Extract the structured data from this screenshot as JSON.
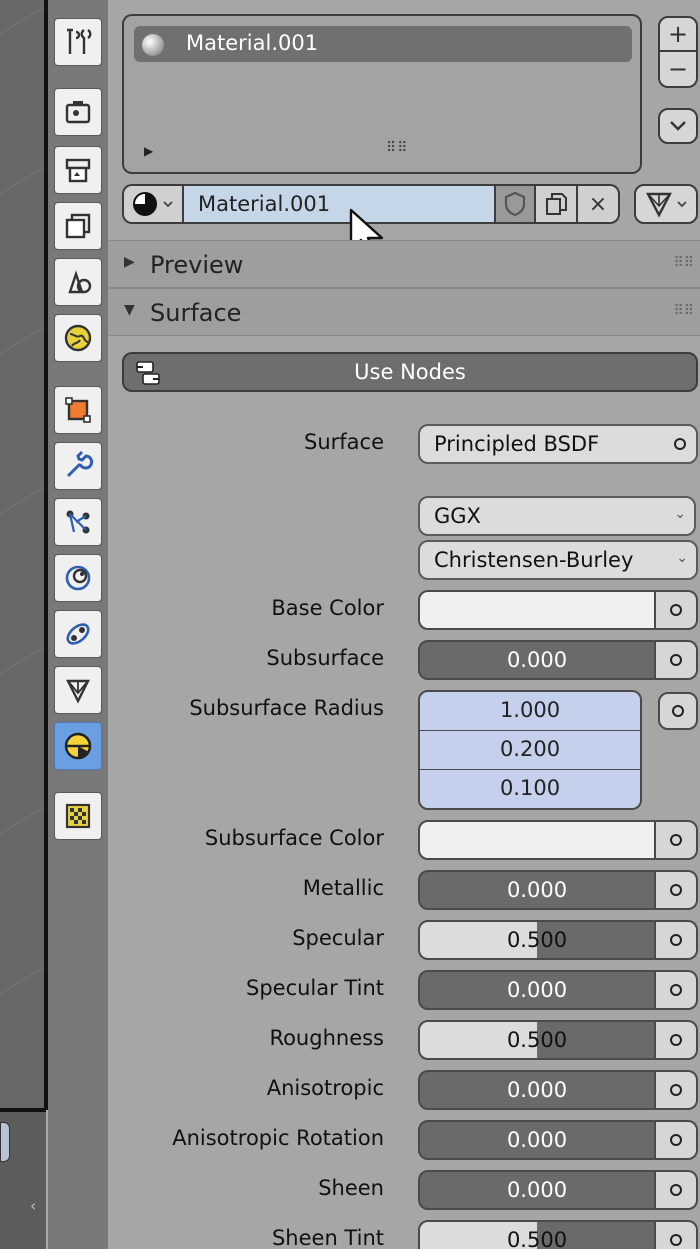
{
  "material_slots": {
    "items": [
      {
        "name": "Material.001"
      }
    ],
    "add_label": "+",
    "remove_label": "−"
  },
  "datablock": {
    "name": "Material.001",
    "unlink_label": "×"
  },
  "panels": {
    "preview": "Preview",
    "surface": "Surface"
  },
  "surface": {
    "use_nodes": "Use Nodes",
    "surface_label": "Surface",
    "surface_shader": "Principled BSDF",
    "distribution": "GGX",
    "subsurface_method": "Christensen-Burley",
    "properties": [
      {
        "label": "Base Color",
        "kind": "color",
        "color": "#f0f0f0"
      },
      {
        "label": "Subsurface",
        "kind": "value",
        "value": "0.000",
        "fraction": 0.0
      },
      {
        "label": "Subsurface Radius",
        "kind": "vector",
        "values": [
          "1.000",
          "0.200",
          "0.100"
        ]
      },
      {
        "label": "Subsurface Color",
        "kind": "color",
        "color": "#f0f0f0"
      },
      {
        "label": "Metallic",
        "kind": "value",
        "value": "0.000",
        "fraction": 0.0
      },
      {
        "label": "Specular",
        "kind": "value",
        "value": "0.500",
        "fraction": 0.5
      },
      {
        "label": "Specular Tint",
        "kind": "value",
        "value": "0.000",
        "fraction": 0.0
      },
      {
        "label": "Roughness",
        "kind": "value",
        "value": "0.500",
        "fraction": 0.5
      },
      {
        "label": "Anisotropic",
        "kind": "value",
        "value": "0.000",
        "fraction": 0.0
      },
      {
        "label": "Anisotropic Rotation",
        "kind": "value",
        "value": "0.000",
        "fraction": 0.0
      },
      {
        "label": "Sheen",
        "kind": "value",
        "value": "0.000",
        "fraction": 0.0
      },
      {
        "label": "Sheen Tint",
        "kind": "value",
        "value": "0.500",
        "fraction": 0.5
      }
    ]
  },
  "tabs": [
    {
      "name": "tools-icon"
    },
    {
      "name": "render-icon"
    },
    {
      "name": "output-icon"
    },
    {
      "name": "view-layer-icon"
    },
    {
      "name": "scene-icon"
    },
    {
      "name": "world-icon"
    },
    {
      "name": "object-icon"
    },
    {
      "name": "modifier-icon"
    },
    {
      "name": "particles-icon"
    },
    {
      "name": "physics-icon"
    },
    {
      "name": "constraints-icon"
    },
    {
      "name": "object-data-icon"
    },
    {
      "name": "material-icon",
      "active": true
    },
    {
      "name": "texture-icon"
    }
  ],
  "colors": {
    "active_tab": "#6a9fe3",
    "value_fill": "#dcdcdc",
    "vector_field": "#c4d0ec",
    "datablock_field": "#c4d6e8"
  }
}
